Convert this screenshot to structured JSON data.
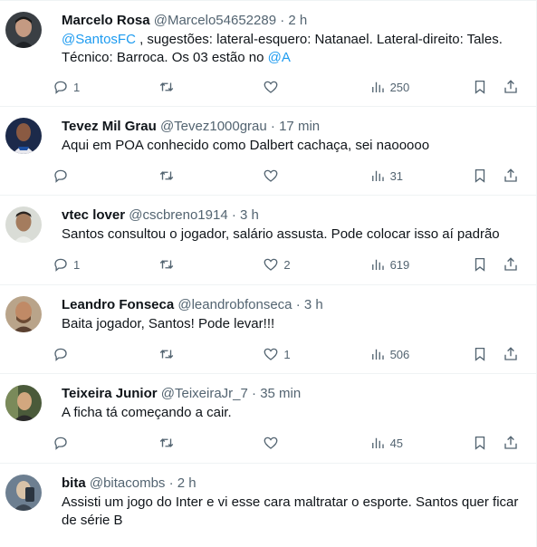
{
  "tweets": [
    {
      "name": "Marcelo Rosa",
      "handle": "@Marcelo54652289",
      "time": "2 h",
      "text_link1": "@SantosFC",
      "text_mid": " , sugestões: lateral-esquero: Natanael. Lateral-direito: Tales. Técnico: Barroca. Os 03 estão no ",
      "text_link2": "@A",
      "replies": "1",
      "retweets": "",
      "likes": "",
      "views": "250",
      "avatar_bg": "#3a3f44",
      "avatar_fg": "#c49a82"
    },
    {
      "name": "Tevez Mil Grau",
      "handle": "@Tevez1000grau",
      "time": "17 min",
      "text": "Aqui em POA conhecido como Dalbert cachaça, sei naooooo",
      "replies": "",
      "retweets": "",
      "likes": "",
      "views": "31",
      "avatar_bg": "#1c2a4a",
      "avatar_fg": "#e8e8ee"
    },
    {
      "name": "vtec lover",
      "handle": "@cscbreno1914",
      "time": "3 h",
      "text": "Santos consultou o jogador, salário assusta. Pode colocar isso aí padrão",
      "replies": "1",
      "retweets": "",
      "likes": "2",
      "views": "619",
      "avatar_bg": "#d9dcd6",
      "avatar_fg": "#8d6e57"
    },
    {
      "name": "Leandro Fonseca",
      "handle": "@leandrobfonseca",
      "time": "3 h",
      "text": "Baita jogador, Santos! Pode levar!!!",
      "replies": "",
      "retweets": "",
      "likes": "1",
      "views": "506",
      "avatar_bg": "#b9a48a",
      "avatar_fg": "#6b4a33"
    },
    {
      "name": "Teixeira Junior",
      "handle": "@TeixeiraJr_7",
      "time": "35 min",
      "text": "A ficha tá começando a cair.",
      "replies": "",
      "retweets": "",
      "likes": "",
      "views": "45",
      "avatar_bg": "#4a5a3a",
      "avatar_fg": "#d2a77f"
    },
    {
      "name": "bita",
      "handle": "@bitacombs",
      "time": "2 h",
      "text": "Assisti um jogo do Inter e vi esse cara maltratar o esporte. Santos quer ficar de série B",
      "avatar_bg": "#6d7f91",
      "avatar_fg": "#d9c3a8"
    }
  ],
  "separator": "·"
}
